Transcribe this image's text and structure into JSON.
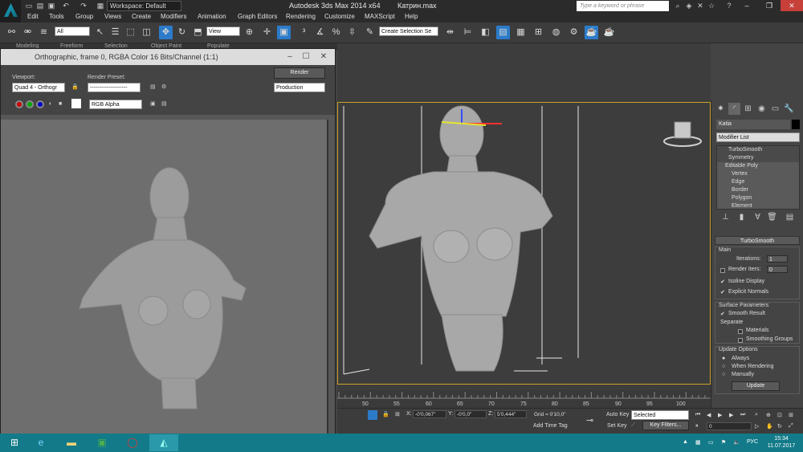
{
  "titlebar": {
    "title": "Autodesk 3ds Max  2014 x64",
    "file": "Катрин.max",
    "workspace": "Workspace: Default",
    "search_placeholder": "Type a keyword or phrase"
  },
  "menu": [
    "Edit",
    "Tools",
    "Group",
    "Views",
    "Create",
    "Modifiers",
    "Animation",
    "Graph Editors",
    "Rendering",
    "Customize",
    "MAXScript",
    "Help"
  ],
  "toolbar": {
    "filter": "All",
    "refcoord": "View",
    "selection_set": "Create Selection Se"
  },
  "ribbon_tabs": [
    "Modeling",
    "Freeform",
    "Selection",
    "Object Paint",
    "Populate"
  ],
  "frame_window": {
    "title": "Orthographic, frame 0, RGBA Color 16 Bits/Channel (1:1)",
    "viewport_label": "Viewport:",
    "viewport_value": "Quad 4 - Orthogr",
    "preset_label": "Render Preset:",
    "preset_value": "--------------------",
    "render_button": "Render",
    "production": "Production",
    "channel": "RGB Alpha"
  },
  "command_panel": {
    "object_name": "Katia",
    "modifier_list": "Modifier List",
    "stack": [
      "TurboSmooth",
      "Symmetry",
      "Editable Poly",
      "Vertex",
      "Edge",
      "Border",
      "Polygon",
      "Element"
    ],
    "rollout_title": "TurboSmooth",
    "main_label": "Main",
    "iterations_label": "Iterations:",
    "iterations_value": "1",
    "render_iters_label": "Render Iters:",
    "render_iters_value": "0",
    "isoline": "Isoline Display",
    "explicit": "Explicit Normals",
    "surface_label": "Surface Parameters",
    "smooth_result": "Smooth Result",
    "separate_label": "Separate",
    "materials": "Materials",
    "smoothing_groups": "Smoothing Groups",
    "update_label": "Update Options",
    "always": "Always",
    "when_rendering": "When Rendering",
    "manually": "Manually",
    "update_button": "Update"
  },
  "timeline": {
    "ticks": [
      "50",
      "55",
      "60",
      "65",
      "70",
      "75",
      "80",
      "85",
      "90",
      "95",
      "100"
    ]
  },
  "statusbar": {
    "x_label": "X:",
    "x_value": "-0'0,067\"",
    "y_label": "Y:",
    "y_value": "-0'0,0\"",
    "z_label": "Z:",
    "z_value": "5'0,444\"",
    "grid": "Grid = 0'10,0\"",
    "add_time_tag": "Add Time Tag",
    "auto_key": "Auto Key",
    "selected": "Selected",
    "set_key": "Set Key",
    "key_filters": "Key Filters...",
    "frame_value": "0"
  },
  "taskbar": {
    "lang": "РУС",
    "time": "15:34",
    "date": "11.07.2017"
  },
  "colors": {
    "accent": "#2c7bc9",
    "viewport_border": "#c9a227",
    "taskbar": "#127a88",
    "close": "#c7403a"
  }
}
